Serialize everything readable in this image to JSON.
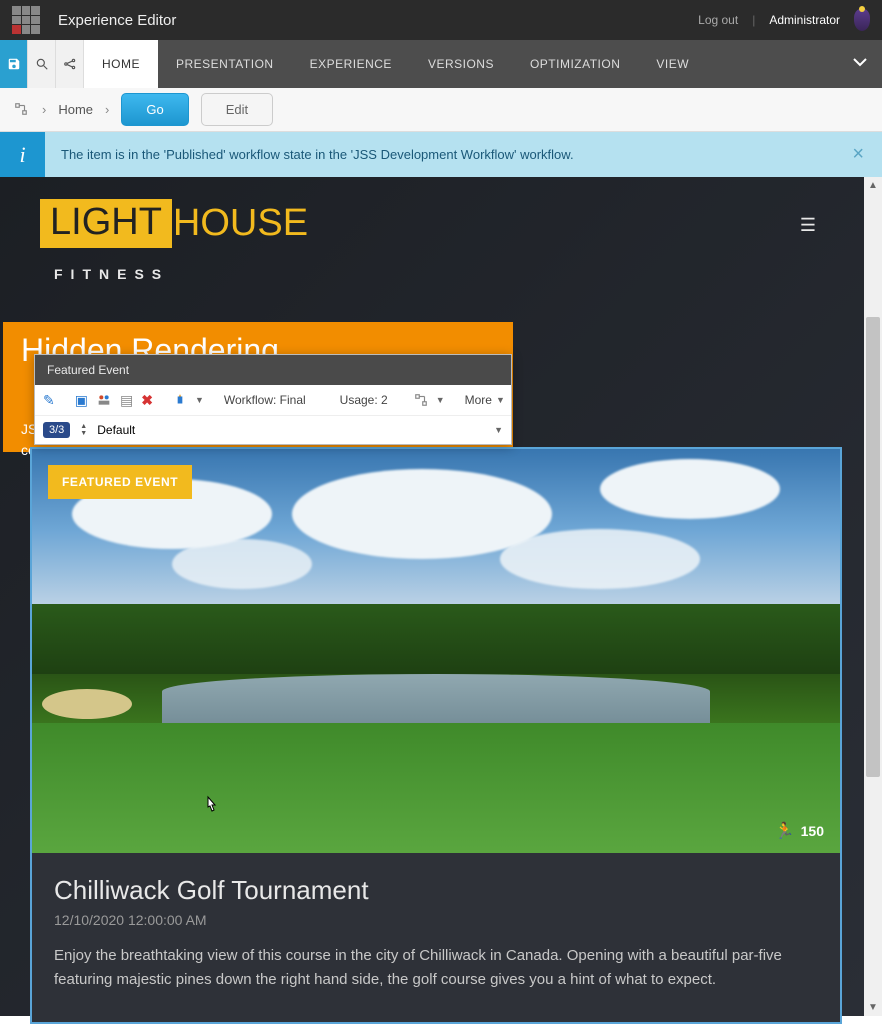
{
  "app": {
    "title": "Experience Editor",
    "logout": "Log out",
    "user": "Administrator"
  },
  "ribbon": {
    "tabs": [
      "HOME",
      "PRESENTATION",
      "EXPERIENCE",
      "VERSIONS",
      "OPTIMIZATION",
      "VIEW"
    ],
    "active_index": 0
  },
  "breadcrumb": {
    "home": "Home",
    "go": "Go",
    "edit": "Edit"
  },
  "notification": {
    "text": "The item is in the 'Published' workflow state in the 'JSS Development Workflow' workflow."
  },
  "site": {
    "logo_part1": "LIGHT",
    "logo_part2": "HOUSE",
    "tagline": "FITNESS"
  },
  "hidden_rendering": {
    "title": "Hidden Rendering",
    "subtitle_line1": "JS",
    "subtitle_line2": "co"
  },
  "toolbar": {
    "header": "Featured Event",
    "workflow": "Workflow: Final",
    "usage": "Usage: 2",
    "more": "More",
    "count": "3/3",
    "variant": "Default"
  },
  "card": {
    "badge": "FEATURED EVENT",
    "participants": "150",
    "title": "Chilliwack Golf Tournament",
    "date": "12/10/2020 12:00:00 AM",
    "description": "Enjoy the breathtaking view of this course in the city of Chilliwack in Canada. Opening with a beautiful par-five featuring majestic pines down the right hand side, the golf course gives you a hint of what to expect."
  }
}
